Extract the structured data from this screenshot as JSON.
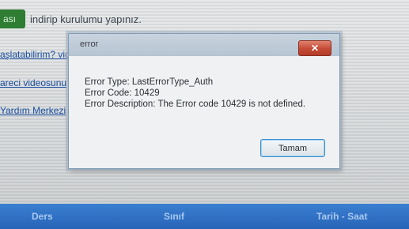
{
  "background": {
    "install_button_label": "ası",
    "install_text": "indirip kurulumu yapınız.",
    "links": [
      "aşlatabilirim? vid",
      "areci videosunu",
      "Yardım Merkezi"
    ]
  },
  "dialog": {
    "title": "error",
    "close_label": "✕",
    "lines": [
      "Error Type: LastErrorType_Auth",
      "Error Code: 10429",
      "Error Description: The Error code 10429 is not defined."
    ],
    "ok_label": "Tamam"
  },
  "footer": {
    "columns": [
      "Ders",
      "Sınıf",
      "Tarih - Saat"
    ]
  },
  "colors": {
    "accent_green": "#2e7d32",
    "footer_blue": "#2864b8",
    "close_red": "#c44a35"
  }
}
